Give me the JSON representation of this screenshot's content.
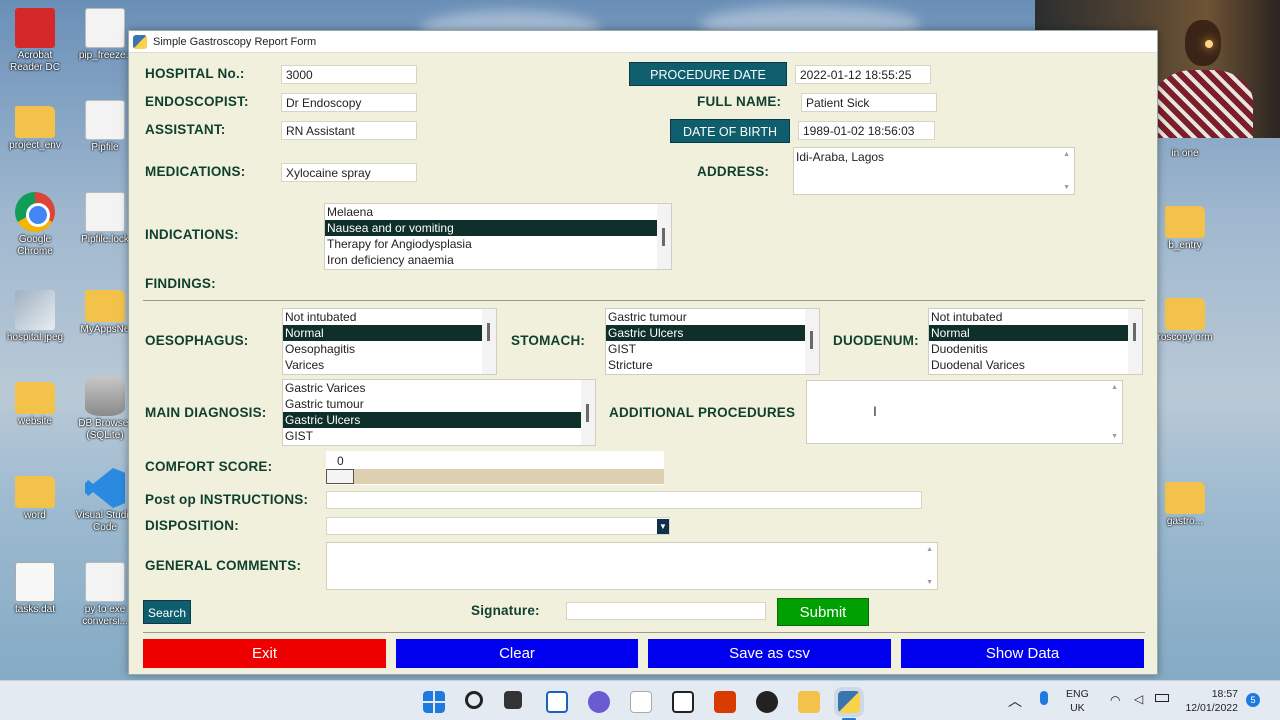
{
  "window": {
    "title": "Simple Gastroscopy Report Form"
  },
  "desktop": {
    "left_col": [
      "Acrobat Reader DC",
      "project_env",
      "Google Chrome",
      "hospital.jpeg",
      "website",
      "word",
      "tasks.dat"
    ],
    "second_col": [
      "pip_freeze.t",
      "Pipfile",
      "Pipfile.lock",
      "MyAppsNe",
      "DB Browser (SQLite)",
      "Visual Studio Code",
      "py to exe conversi..."
    ],
    "right_col": [
      "in one",
      "b_entry",
      "roscopy orm",
      "gastro..."
    ]
  },
  "form": {
    "hospital_label": "HOSPITAL No.:",
    "hospital_value": "3000",
    "endoscopist_label": "ENDOSCOPIST:",
    "endoscopist_value": "Dr Endoscopy",
    "assistant_label": "ASSISTANT:",
    "assistant_value": "RN Assistant",
    "medications_label": "MEDICATIONS:",
    "medications_value": "Xylocaine spray",
    "procedure_date_btn": "PROCEDURE DATE",
    "procedure_date_value": "2022-01-12 18:55:25",
    "full_name_label": "FULL NAME:",
    "full_name_value": "Patient Sick",
    "dob_btn": "DATE OF BIRTH",
    "dob_value": "1989-01-02 18:56:03",
    "address_label": "ADDRESS:",
    "address_value": "Idi-Araba, Lagos",
    "indications_label": "INDICATIONS:",
    "indications": [
      "Melaena",
      "Nausea and or vomiting",
      "Therapy for Angiodysplasia",
      "Iron deficiency anaemia"
    ],
    "findings_label": "FINDINGS:",
    "oesophagus_label": "OESOPHAGUS:",
    "oesophagus": [
      "Not intubated",
      "Normal",
      "Oesophagitis",
      "Varices"
    ],
    "stomach_label": "STOMACH:",
    "stomach": [
      "Gastric tumour",
      "Gastric Ulcers",
      "GIST",
      "Stricture"
    ],
    "duodenum_label": "DUODENUM:",
    "duodenum": [
      "Not intubated",
      "Normal",
      "Duodenitis",
      "Duodenal Varices"
    ],
    "main_diagnosis_label": "MAIN DIAGNOSIS:",
    "main_diagnosis": [
      "Gastric Varices",
      "Gastric tumour",
      "Gastric Ulcers",
      "GIST"
    ],
    "additional_procedures_label": "ADDITIONAL PROCEDURES",
    "comfort_label": "COMFORT SCORE:",
    "comfort_value": "0",
    "postop_label": "Post op INSTRUCTIONS:",
    "disposition_label": "DISPOSITION:",
    "general_comments_label": "GENERAL COMMENTS:",
    "search_btn": "Search",
    "signature_label": "Signature:",
    "submit_btn": "Submit",
    "exit_btn": "Exit",
    "clear_btn": "Clear",
    "save_btn": "Save as csv",
    "show_btn": "Show Data"
  },
  "taskbar": {
    "lang": "ENG",
    "region": "UK",
    "time": "18:57",
    "date": "12/01/2022",
    "badge": "5"
  },
  "colors": {
    "teal": "#0e5e6e",
    "red": "#ee0000",
    "blue": "#0000ee",
    "green": "#00a000",
    "selected": "#0f2f2a"
  }
}
